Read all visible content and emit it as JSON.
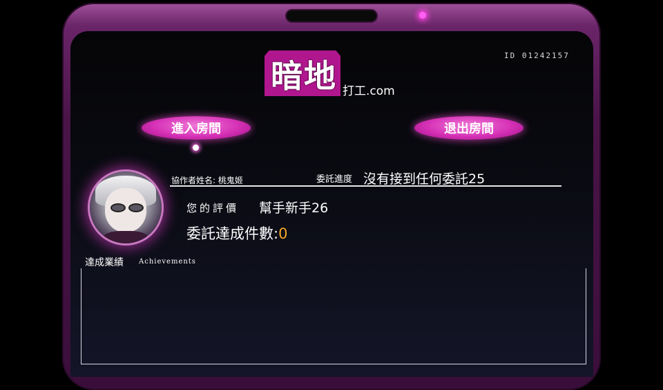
{
  "header": {
    "id_label": "ID  01242157",
    "logo_main": "暗地",
    "logo_sub": "打工.com"
  },
  "buttons": {
    "enter_room": "進入房間",
    "exit_room": "退出房間"
  },
  "profile": {
    "collaborator_label": "協作者姓名: 桃鬼姬",
    "progress_label": "委託進度",
    "progress_value": "沒有接到任何委託25",
    "rating_label": "您的評價",
    "rating_value": "幫手新手26",
    "completed_label": "委託達成件數:",
    "completed_value": "0"
  },
  "achievements": {
    "title": "達成業績",
    "subtitle": "Achievements"
  },
  "colors": {
    "accent_pink": "#d631b6",
    "highlight_orange": "#f5a623"
  }
}
